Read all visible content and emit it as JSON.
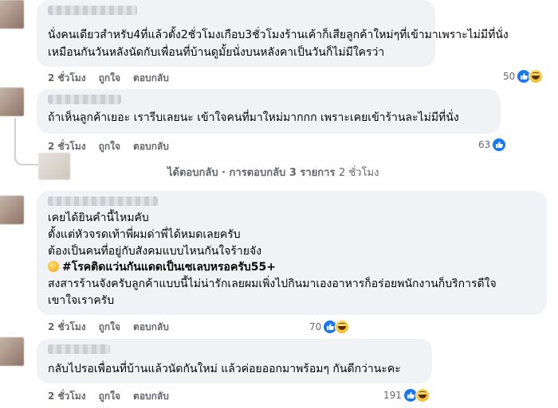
{
  "comments": [
    {
      "lines": [
        "นั่งคนเดียวสำหรับ4ที่แล้วตั้ง2ชั่วโมงเกือบ3ชั่วโมงร้านเค้าก็เสียลูกค้าใหม่ๆที่เข้ามาเพราะไม่มีที่นั่ง",
        "เหมือนกันวันหลังนัดกับเพื่อนที่บ้านดูมั้ยนั่งบนหลังคาเป็นวันก็ไม่มีใครว่า"
      ],
      "time": "2 ชั่วโมง",
      "like": "ถูกใจ",
      "reply": "ตอบกลับ",
      "reaction_count": "50",
      "reactions": [
        "like-icon",
        "haha-icon"
      ]
    },
    {
      "lines": [
        "ถ้าเห็นลูกค้าเยอะ เรารีบเลยนะ เข้าใจคนที่มาใหม่มากกก เพราะเคยเข้าร้านละไม่มีที่นั่ง"
      ],
      "time": "2 ชั่วโมง",
      "like": "ถูกใจ",
      "reply": "ตอบกลับ",
      "reaction_count": "63",
      "reactions": [
        "like-icon"
      ]
    },
    {
      "lines": [
        "เคยได้ยินคำนี้ไหมคับ",
        "ตั้งแต่หัวจรดเท้าพี่ผมด่าพี่ได้หมดเลยครับ",
        "ต้องเป็นคนที่อยู่กับสังคมแบบไหนกันใจร้ายจัง",
        "#โรคติดแว่นกันแดดเป็นเซเลบหรอครับ55+",
        "สงสารร้านจังครับลูกค้าแบบนี้ไม่น่ารักเลยผมเพิ่งไปกินมาเองอาหารก็อร่อยพนักงานก็บริการดีใจ",
        "เขาใจเราครับ"
      ],
      "time": "2 ชั่วโมง",
      "like": "ถูกใจ",
      "reply": "ตอบกลับ",
      "reaction_count": "70",
      "reactions": [
        "like-icon",
        "haha-icon"
      ]
    },
    {
      "lines": [
        "กลับไปรอเพื่อนที่บ้านแล้วนัดกันใหม่ แล้วค่อยออกมาพร้อมๆ กันดีกว่านะคะ"
      ],
      "time": "2 ชั่วโมง",
      "like": "ถูกใจ",
      "reply": "ตอบกลับ",
      "reaction_count": "191",
      "reactions": [
        "like-icon",
        "haha-icon"
      ]
    }
  ],
  "reply_thread": {
    "label": "ได้ตอบกลับ · การตอบกลับ 3 รายการ",
    "time": "2 ชั่วโมง"
  },
  "colors": {
    "bubble": "#f0f2f5",
    "meta_text": "#65676b",
    "like_blue": "#1877f2"
  }
}
